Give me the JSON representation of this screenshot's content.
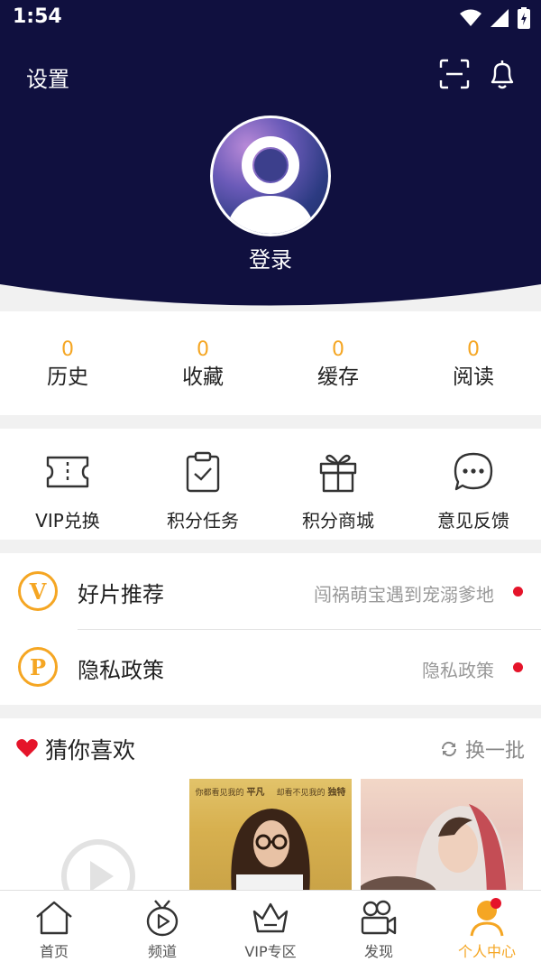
{
  "status_bar": {
    "time": "1:54",
    "icons": [
      "wifi-icon",
      "signal-icon",
      "battery-icon"
    ]
  },
  "header": {
    "settings_label": "设置",
    "scan_icon": "scan-icon",
    "bell_icon": "bell-icon",
    "avatar_icon": "user-avatar-icon",
    "login_label": "登录",
    "bg_color": "#10103f"
  },
  "stats": [
    {
      "value": "0",
      "label": "历史"
    },
    {
      "value": "0",
      "label": "收藏"
    },
    {
      "value": "0",
      "label": "缓存"
    },
    {
      "value": "0",
      "label": "阅读"
    }
  ],
  "tools": [
    {
      "icon": "ticket-icon",
      "label": "VIP兑换"
    },
    {
      "icon": "clipboard-check-icon",
      "label": "积分任务"
    },
    {
      "icon": "gift-icon",
      "label": "积分商城"
    },
    {
      "icon": "chat-bubble-icon",
      "label": "意见反馈"
    }
  ],
  "list": [
    {
      "badge": "V",
      "title": "好片推荐",
      "subtitle": "闯祸萌宝遇到宠溺爹地"
    },
    {
      "badge": "P",
      "title": "隐私政策",
      "subtitle": "隐私政策"
    }
  ],
  "guess": {
    "title": "猜你喜欢",
    "refresh_label": "换一批",
    "poster1_caption_left": "你都看见我的",
    "poster1_caption_left_bold": "平凡",
    "poster1_caption_right": "却看不见我的",
    "poster1_caption_right_bold": "独特"
  },
  "tabs": [
    {
      "icon": "home-icon",
      "label": "首页"
    },
    {
      "icon": "tv-play-icon",
      "label": "频道"
    },
    {
      "icon": "crown-icon",
      "label": "VIP专区"
    },
    {
      "icon": "camera-icon",
      "label": "发现"
    },
    {
      "icon": "person-icon",
      "label": "个人中心"
    }
  ],
  "colors": {
    "accent": "#f5a623",
    "header": "#10103f",
    "red_dot": "#e5142a"
  }
}
